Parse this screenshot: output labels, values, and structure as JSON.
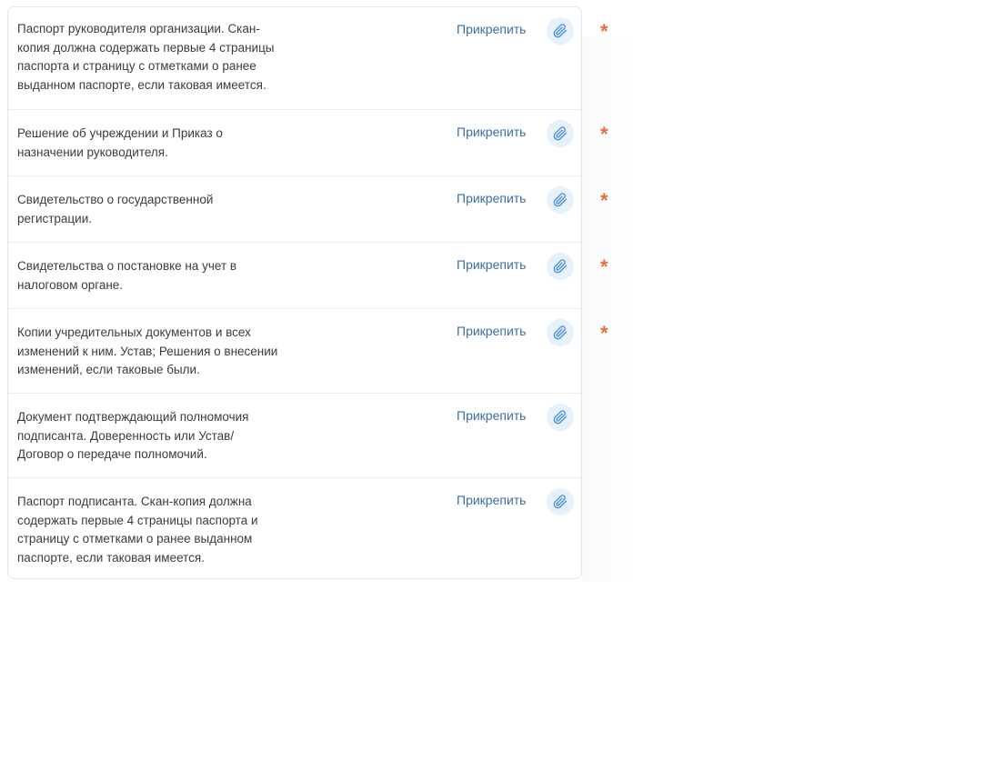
{
  "documents": [
    {
      "label": "Паспорт руководителя организации. Скан-копия должна содержать первые 4 страницы паспорта и страницу с отметками о ранее выданном паспорте, если таковая имеется.",
      "attach_label": "Прикрепить",
      "required": true
    },
    {
      "label": "Решение об учреждении и Приказ о назначении руководителя.",
      "attach_label": "Прикрепить",
      "required": true
    },
    {
      "label": "Свидетельство о государственной регистрации.",
      "attach_label": "Прикрепить",
      "required": true
    },
    {
      "label": "Свидетельства о постановке на учет в налоговом органе.",
      "attach_label": "Прикрепить",
      "required": true
    },
    {
      "label": "Копии учредительных документов и всех изменений к ним. Устав; Решения о внесении изменений, если таковые были.",
      "attach_label": "Прикрепить",
      "required": true
    },
    {
      "label": "Документ подтверждающий полномочия подписанта. Доверенность или Устав/ Договор о передаче полномочий.",
      "attach_label": "Прикрепить",
      "required": false
    },
    {
      "label": "Паспорт подписанта. Скан-копия должна содержать первые 4 страницы паспорта и страницу с отметками о ранее выданном паспорте, если таковая имеется.",
      "attach_label": "Прикрепить",
      "required": false
    }
  ],
  "required_marker": "*",
  "icons": {
    "attach": "paperclip-icon"
  },
  "colors": {
    "link": "#3a6ea5",
    "attach_button_bg": "#e6f1fb",
    "required_marker": "#e2703f"
  }
}
